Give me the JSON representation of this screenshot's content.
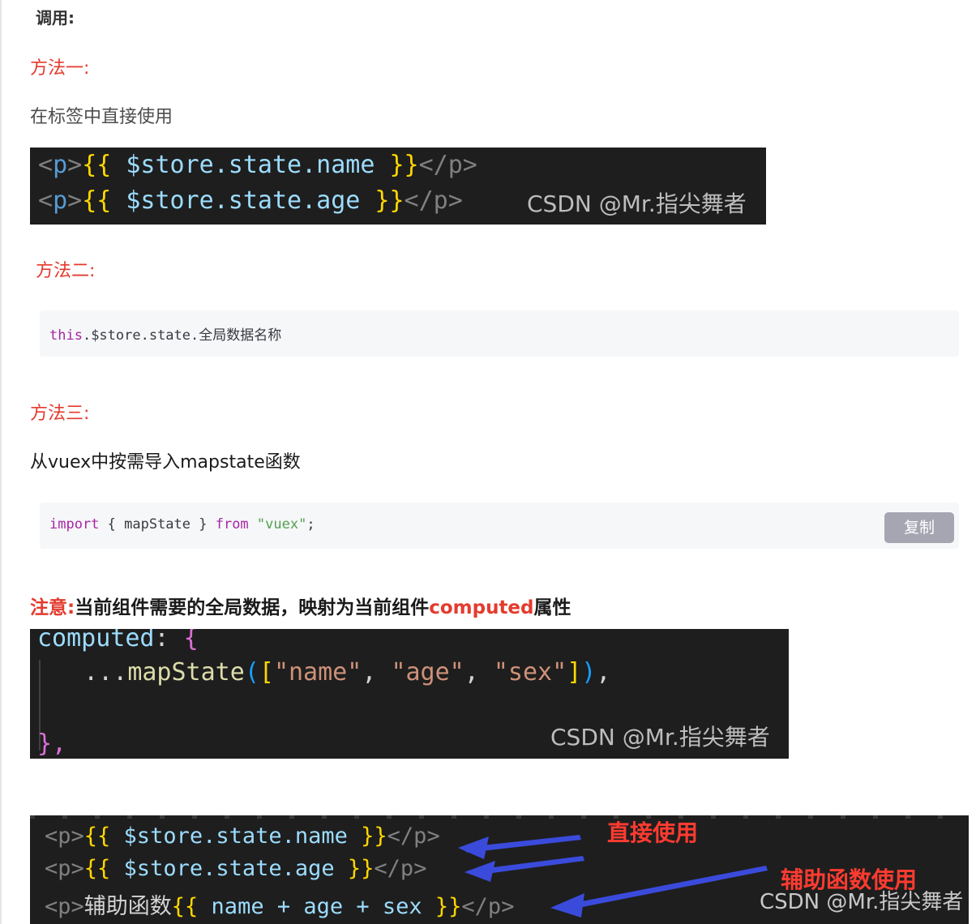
{
  "heading": "调用:",
  "method1": {
    "title": "方法一:",
    "desc": "在标签中直接使用",
    "code_image": {
      "line1": {
        "open_lt": "<",
        "open_tag": "p",
        "open_gt": ">",
        "brace_open": "{{",
        "expr": " $store.state.name ",
        "brace_close": "}}",
        "close": "</p>"
      },
      "line2": {
        "open_lt": "<",
        "open_tag": "p",
        "open_gt": ">",
        "brace_open": "{{",
        "expr": " $store.state.age ",
        "brace_close": "}}",
        "close": "</p>"
      },
      "watermark": "CSDN @Mr.指尖舞者"
    }
  },
  "method2": {
    "title": "方法二:",
    "code": {
      "keyword": "this",
      "rest": ".$store.state.全局数据名称"
    }
  },
  "method3": {
    "title": "方法三:",
    "desc": "从vuex中按需导入mapstate函数",
    "code": {
      "kw_import": "import",
      "middle": " { mapState } ",
      "kw_from": "from",
      "space": " ",
      "string": "\"vuex\"",
      "end": ";"
    },
    "copy_label": "复制"
  },
  "note": {
    "prefix": "注意:",
    "text_a": "当前组件需要的全局数据，映射为当前组件",
    "highlight": "computed",
    "text_b": "属性"
  },
  "computed_image": {
    "line1_key": "computed",
    "line1_colon": ": ",
    "line1_brace": "{",
    "line2_spread": "  ...",
    "line2_fn": "mapState",
    "line2_paren_open": "(",
    "line2_bracket_open": "[",
    "line2_s1": "\"name\"",
    "line2_c1": ", ",
    "line2_s2": "\"age\"",
    "line2_c2": ", ",
    "line2_s3": "\"sex\"",
    "line2_bracket_close": "]",
    "line2_paren_close": ")",
    "line2_end": ",",
    "line3": "},",
    "watermark": "CSDN @Mr.指尖舞者"
  },
  "bottom_image": {
    "line1": {
      "open": "<p>",
      "brace_open": "{{",
      "expr": " $store.state.name ",
      "brace_close": "}}",
      "close": "</p>"
    },
    "line2": {
      "open": "<p>",
      "brace_open": "{{",
      "expr": " $store.state.age ",
      "brace_close": "}}",
      "close": "</p>"
    },
    "line3": {
      "open": "<p>",
      "label": "辅助函数",
      "brace_open": "{{",
      "expr": " name + age + sex ",
      "brace_close": "}}",
      "close": "</p>"
    },
    "annotation_direct": "直接使用",
    "annotation_helper": "辅助函数使用",
    "watermark": "CSDN @Mr.指尖舞者",
    "arrow_color": "#3a4bdc"
  },
  "colors": {
    "accent_red": "#e33b2e",
    "code_bg_dark": "#1e1e1e",
    "code_bg_light": "#f6f7f8",
    "copy_button": "#a6a6b3"
  }
}
